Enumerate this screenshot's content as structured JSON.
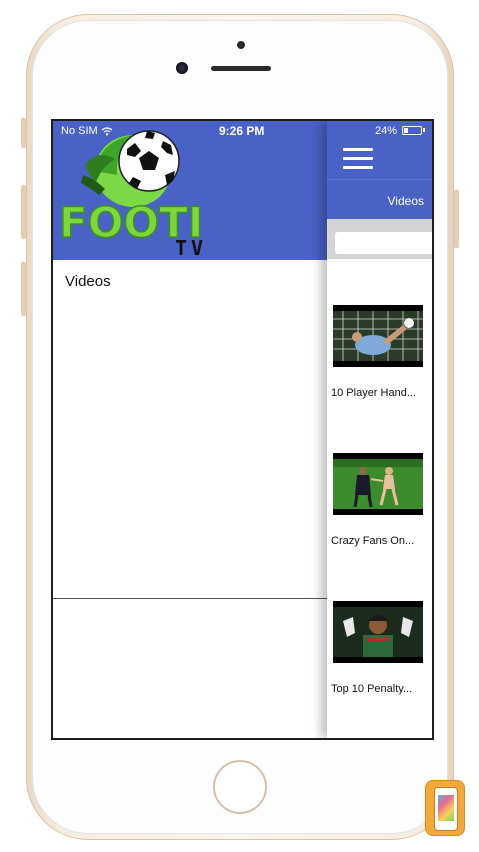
{
  "status_bar": {
    "carrier": "No SIM",
    "time": "9:26 PM",
    "battery_percent": "24%",
    "battery_level": 0.24
  },
  "side_menu": {
    "logo_text": "FOOTI",
    "logo_subtext": "TV",
    "items": [
      {
        "label": "Videos"
      }
    ]
  },
  "main": {
    "tab_label": "Videos",
    "search": {
      "placeholder": "",
      "value": ""
    },
    "videos": [
      {
        "title": "10 Player Hand..."
      },
      {
        "title": "Crazy Fans On..."
      },
      {
        "title": "Top 10 Penalty..."
      }
    ]
  },
  "colors": {
    "header_blue": "#4a62c6",
    "logo_green": "#6fd13b",
    "frame_gold": "#e9d7c3"
  },
  "icons": [
    "hamburger-menu-icon",
    "soccer-ball-icon",
    "battery-icon",
    "wifi-icon",
    "home-button"
  ]
}
